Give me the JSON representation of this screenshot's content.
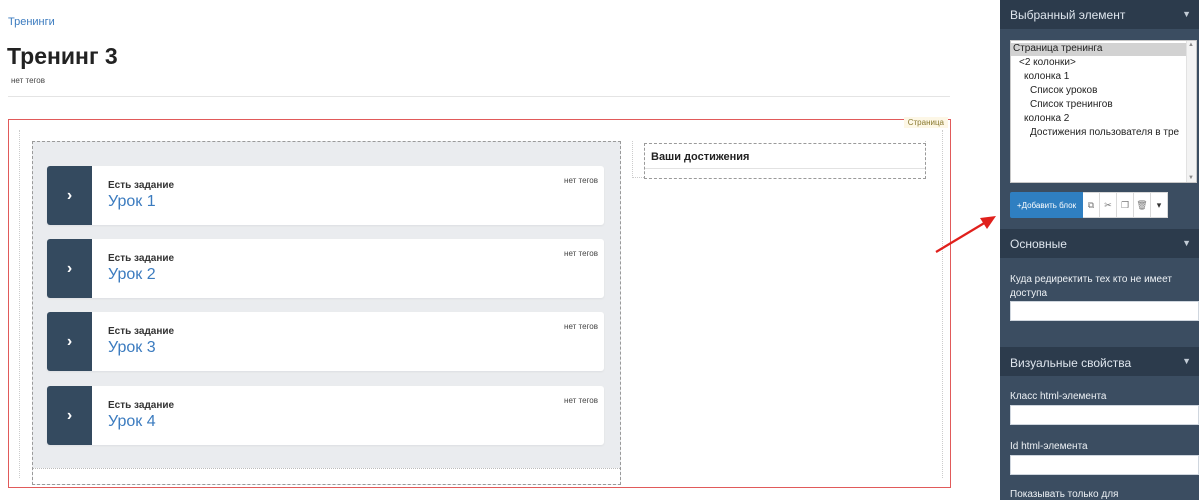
{
  "breadcrumb": "Тренинги",
  "page": {
    "title": "Тренинг 3",
    "tags": "нет тегов",
    "frame_label": "Страница"
  },
  "lessons": [
    {
      "task": "Есть задание",
      "title": "Урок 1",
      "tags": "нет тегов",
      "arrow": "›"
    },
    {
      "task": "Есть задание",
      "title": "Урок 2",
      "tags": "нет тегов",
      "arrow": "›"
    },
    {
      "task": "Есть задание",
      "title": "Урок 3",
      "tags": "нет тегов",
      "arrow": "›"
    },
    {
      "task": "Есть задание",
      "title": "Урок 4",
      "tags": "нет тегов",
      "arrow": "›"
    }
  ],
  "achievements": {
    "title": "Ваши достижения"
  },
  "sidebar": {
    "selected_header": "Выбранный элемент",
    "tree": [
      "Страница тренинга",
      "<2 колонки>",
      "колонка 1",
      "Список уроков",
      "Список тренингов",
      "колонка 2",
      "Достижения пользователя в тре"
    ],
    "add_block": "+Добавить блок",
    "main_header": "Основные",
    "redirect_label": "Куда редиректить тех кто не имеет доступа",
    "redirect_value": "",
    "visual_header": "Визуальные свойства",
    "class_label": "Класс html-элемента",
    "class_value": "",
    "id_label": "Id html-элемента",
    "id_value": "",
    "show_only_label": "Показывать только для"
  },
  "icons": {
    "chevron": "chevron-down-icon",
    "copy": "copy-icon",
    "cut": "cut-icon",
    "paste": "paste-icon",
    "delete": "trash-icon",
    "more": "caret-down-icon"
  },
  "colors": {
    "accent": "#2f7fc1",
    "sidebar": "#3b4d61",
    "lesson_arrow_bg": "#344a5f",
    "link": "#3b7bbf",
    "frame_border": "#e15a5a"
  }
}
